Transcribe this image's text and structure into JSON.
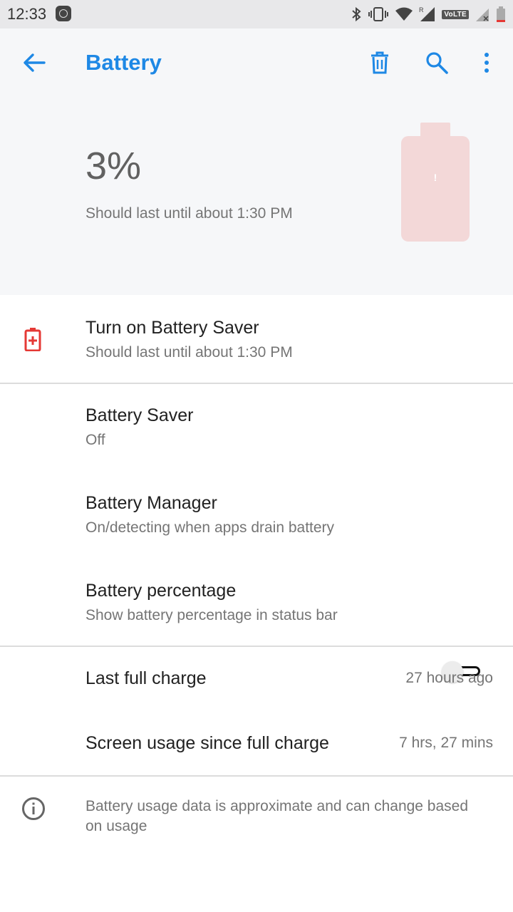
{
  "status_bar": {
    "time": "12:33",
    "network_label": "VoLTE",
    "roaming_label": "R"
  },
  "toolbar": {
    "title": "Battery",
    "icons": [
      "back-arrow-icon",
      "delete-icon",
      "search-icon",
      "more-vert-icon"
    ]
  },
  "header": {
    "percent": "3%",
    "remaining": "Should last until about 1:30 PM",
    "battery_exclaim": "!"
  },
  "items": {
    "saver_tip": {
      "title": "Turn on Battery Saver",
      "subtitle": "Should last until about 1:30 PM"
    },
    "battery_saver": {
      "title": "Battery Saver",
      "subtitle": "Off"
    },
    "battery_manager": {
      "title": "Battery Manager",
      "subtitle": "On/detecting when apps drain battery"
    },
    "battery_percentage": {
      "title": "Battery percentage",
      "subtitle": "Show battery percentage in status bar",
      "enabled": false
    },
    "last_full_charge": {
      "title": "Last full charge",
      "value": "27 hours ago"
    },
    "screen_usage": {
      "title": "Screen usage since full charge",
      "value": "7 hrs, 27 mins"
    }
  },
  "footer": {
    "info": "Battery usage data is approximate and can change based on usage"
  },
  "colors": {
    "accent": "#1e88e5",
    "warning_red": "#e53935",
    "battery_fill": "#f3d8d8"
  }
}
